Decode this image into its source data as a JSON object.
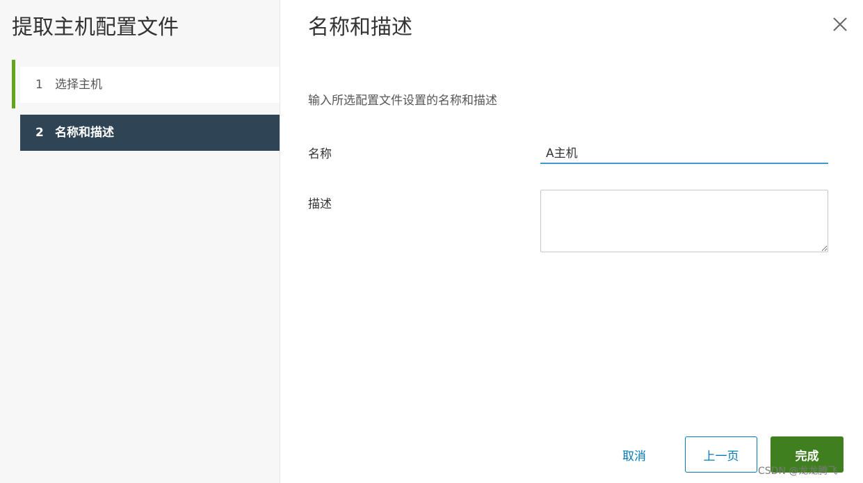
{
  "wizard": {
    "title": "提取主机配置文件",
    "steps": [
      {
        "number": "1",
        "label": "选择主机",
        "state": "completed"
      },
      {
        "number": "2",
        "label": "名称和描述",
        "state": "active"
      }
    ]
  },
  "page": {
    "title": "名称和描述",
    "intro": "输入所选配置文件设置的名称和描述",
    "close_icon": "close-icon"
  },
  "form": {
    "name_label": "名称",
    "name_value": "A主机",
    "desc_label": "描述",
    "desc_value": ""
  },
  "footer": {
    "cancel_label": "取消",
    "back_label": "上一页",
    "finish_label": "完成"
  },
  "watermark": "CSDN @龙龙腾飞",
  "colors": {
    "active_step_bg": "#2f4455",
    "completed_step_bar": "#62a420",
    "primary_button": "#3f7f1f",
    "link_blue": "#0079b8",
    "input_focus": "#3f9ad3"
  }
}
